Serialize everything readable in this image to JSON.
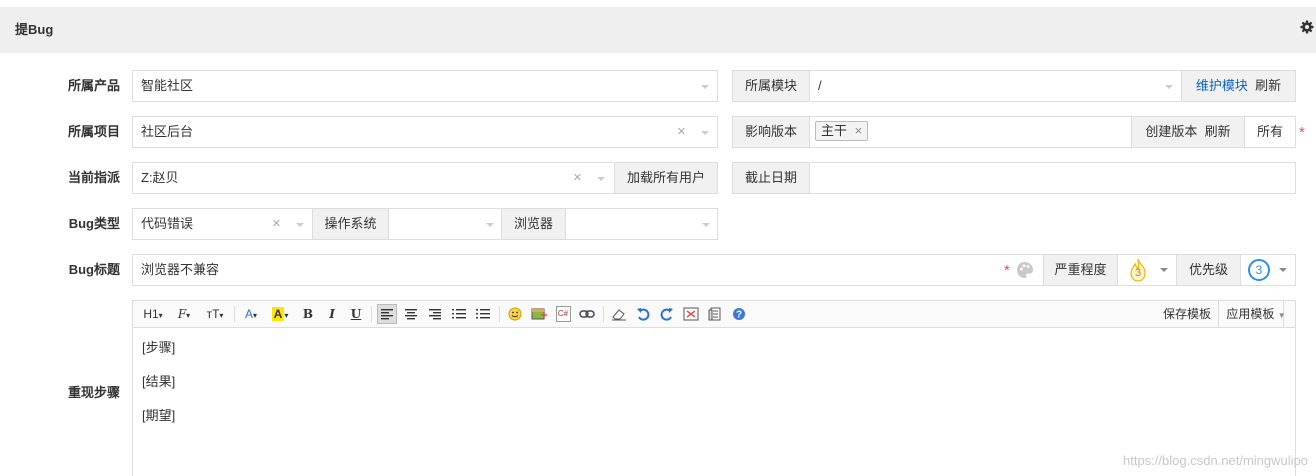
{
  "header": {
    "title": "提Bug",
    "settings_icon": "gear-icon"
  },
  "rows": {
    "product": {
      "label": "所属产品",
      "value": "智能社区"
    },
    "module": {
      "label": "所属模块",
      "value": "/",
      "maintain_link": "维护模块",
      "refresh_link": "刷新"
    },
    "project": {
      "label": "所属项目",
      "value": "社区后台"
    },
    "build": {
      "label": "影响版本",
      "tag": "主干",
      "create_build": "创建版本",
      "refresh": "刷新",
      "all": "所有",
      "required": "*"
    },
    "assigned": {
      "label": "当前指派",
      "value": "Z:赵贝",
      "load_all": "加载所有用户"
    },
    "deadline": {
      "label": "截止日期",
      "value": ""
    },
    "type": {
      "label": "Bug类型",
      "value": "代码错误",
      "os_label": "操作系统",
      "os_value": "",
      "browser_label": "浏览器",
      "browser_value": ""
    },
    "title": {
      "label": "Bug标题",
      "value": "浏览器不兼容",
      "required": "*",
      "severity_label": "严重程度",
      "severity_value": "3",
      "priority_label": "优先级",
      "priority_value": "3"
    },
    "steps": {
      "label": "重现步骤",
      "toolbar": {
        "h1": "H1",
        "font": "F",
        "size": "тT",
        "save_template": "保存模板",
        "apply_template": "应用模板"
      },
      "lines": [
        "[步骤]",
        "[结果]",
        "[期望]"
      ]
    }
  },
  "watermark": "https://blog.csdn.net/mingwulipo"
}
